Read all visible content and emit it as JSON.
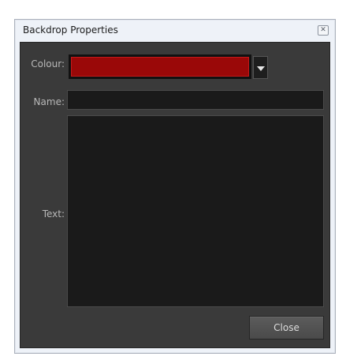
{
  "window": {
    "title": "Backdrop Properties",
    "close_glyph": "✕"
  },
  "form": {
    "colour_label": "Colour:",
    "colour_value": "#9a0808",
    "name_label": "Name:",
    "name_value": "",
    "text_label": "Text:",
    "text_value": ""
  },
  "footer": {
    "close_label": "Close"
  },
  "icons": {
    "window_close": "close-icon",
    "dropdown": "chevron-down-icon"
  },
  "colors": {
    "dialog_background": "#3a3a3a",
    "field_background": "#1a1a1a",
    "titlebar_background": "#eef2f8"
  }
}
